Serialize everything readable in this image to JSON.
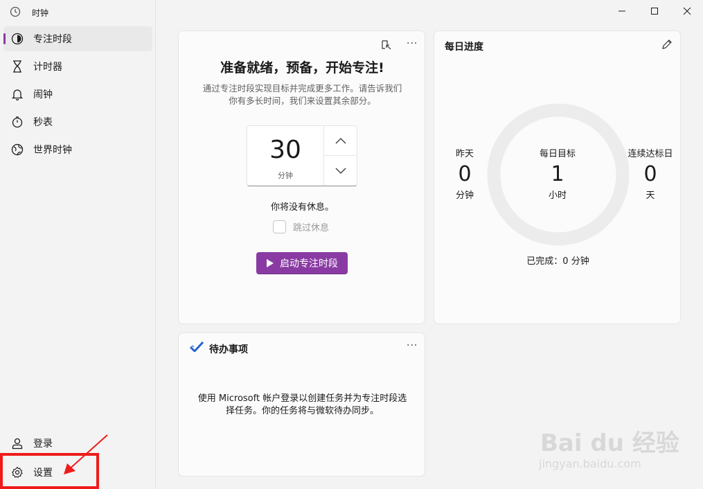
{
  "app": {
    "title": "时钟"
  },
  "nav": {
    "focus": "专注时段",
    "timer": "计时器",
    "alarm": "闹钟",
    "stopwatch": "秒表",
    "world_clock": "世界时钟",
    "sign_in": "登录",
    "settings": "设置"
  },
  "focus_card": {
    "heading": "准备就绪，预备，开始专注!",
    "desc_line1": "通过专注时段实现目标并完成更多工作。请告诉我们",
    "desc_line2": "你有多长时间，我们来设置其余部分。",
    "minutes_value": "30",
    "minutes_unit": "分钟",
    "no_break_text": "你将没有休息。",
    "skip_break_label": "跳过休息",
    "start_button": "启动专注时段"
  },
  "daily_progress": {
    "title": "每日进度",
    "yesterday_label": "昨天",
    "yesterday_value": "0",
    "yesterday_unit": "分钟",
    "goal_label": "每日目标",
    "goal_value": "1",
    "goal_unit": "小时",
    "streak_label": "连续达标日",
    "streak_value": "0",
    "streak_unit": "天",
    "completed_text": "已完成：0 分钟",
    "progress_fraction": 0
  },
  "todo_card": {
    "title": "待办事项",
    "message_line1": "使用 Microsoft 帐户登录以创建任务并为专注时段选",
    "message_line2": "择任务。你的任务将与微软待办同步。"
  },
  "watermark": {
    "brand": "Bai du 经验",
    "url": "jingyan.baidu.com"
  },
  "colors": {
    "accent": "#8a3ba3",
    "highlight": "#ef1b1b",
    "todo_icon": "#2564cf"
  }
}
